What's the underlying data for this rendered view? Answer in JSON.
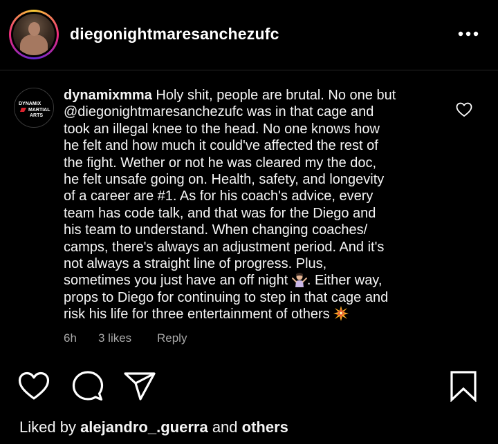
{
  "header": {
    "username": "diegonightmaresanchezufc",
    "avatar_icon": "profile-photo-fighter",
    "more_icon": "more-horizontal-icon"
  },
  "comment": {
    "avatar_logo_lines": [
      "DYNAMIX",
      "MARTIAL",
      "ARTS"
    ],
    "username": "dynamixmma",
    "text_part1": " Holy shit, people are brutal. No one but\n@diegonightmaresanchezufc was in that cage and\ntook an illegal knee to the head. No one knows how\nhe felt and how much it could've affected the rest of\nthe fight. Wether or not he was cleared my the doc,\nhe felt unsafe going on. Health, safety, and longevity\nof a career are #1. As for his coach's advice, every\nteam has code talk, and that was for the Diego and\nhis team to understand. When changing coaches/\ncamps, there's always an adjustment period. And it's\nnot always a straight line of progress.  Plus,\nsometimes you just have an off night ",
    "emoji1": "person-shrugging-emoji",
    "text_part2": ". Either way,\nprops to Diego for continuing to step in that cage and\nrisk his life for three entertainment of others ",
    "emoji2": "collision-emoji",
    "time": "6h",
    "likes": "3 likes",
    "reply": "Reply",
    "like_icon": "heart-outline-icon"
  },
  "actions": {
    "like_icon": "heart-outline-icon",
    "comment_icon": "comment-bubble-icon",
    "share_icon": "paper-plane-icon",
    "save_icon": "bookmark-icon"
  },
  "liked_by": {
    "prefix": "Liked by ",
    "user": "alejandro_.guerra",
    "middle": " and ",
    "others": "others"
  },
  "colors": {
    "background": "#000000",
    "text": "#f5f5f5",
    "secondary": "#a8a8a8",
    "divider": "#262626"
  }
}
